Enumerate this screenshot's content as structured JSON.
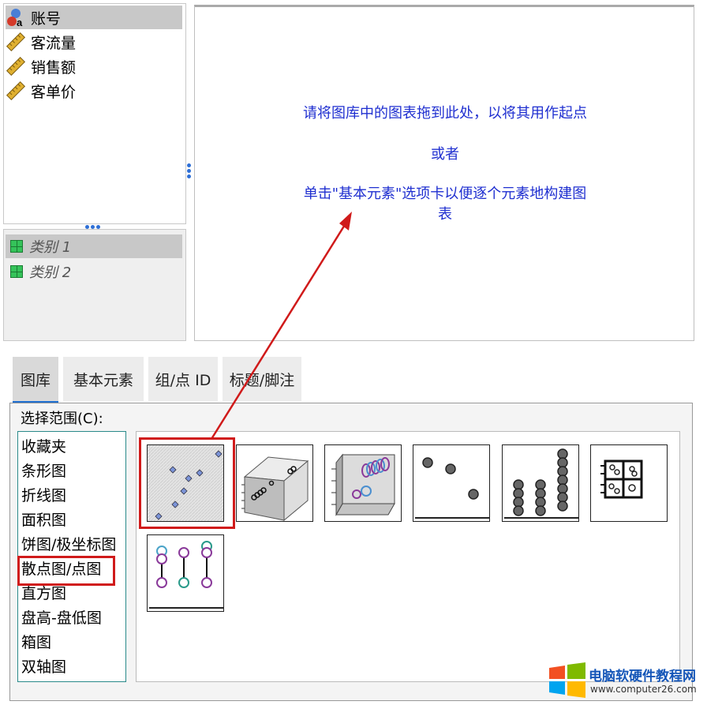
{
  "variables": [
    {
      "label": "账号",
      "icon": "nominal-variable-icon"
    },
    {
      "label": "客流量",
      "icon": "scale-ruler-icon"
    },
    {
      "label": "销售额",
      "icon": "scale-ruler-icon"
    },
    {
      "label": "客单价",
      "icon": "scale-ruler-icon"
    }
  ],
  "categories": [
    {
      "label": "类别 1"
    },
    {
      "label": "类别 2"
    }
  ],
  "canvas": {
    "line1": "请将图库中的图表拖到此处，以将其用作起点",
    "line2": "或者",
    "line3a": "单击\"基本元素\"选项卡以便逐个元素地构建图",
    "line3b": "表"
  },
  "tabs": [
    {
      "label": "图库",
      "active": true
    },
    {
      "label": "基本元素"
    },
    {
      "label": "组/点 ID"
    },
    {
      "label": "标题/脚注"
    }
  ],
  "gallery": {
    "range_label": "选择范围(C):",
    "types": [
      "收藏夹",
      "条形图",
      "折线图",
      "面积图",
      "饼图/极坐标图",
      "散点图/点图",
      "直方图",
      "盘高-盘低图",
      "箱图",
      "双轴图"
    ],
    "selected_type": "散点图/点图",
    "thumbnails": [
      "simple-scatter-thumb",
      "3d-scatter-thumb",
      "grouped-3d-scatter-thumb",
      "simple-dot-plot-thumb",
      "stacked-dot-plot-thumb",
      "scatter-matrix-thumb",
      "drop-line-thumb"
    ]
  },
  "colors": {
    "hint_text": "#1f2fd0",
    "highlight": "#d01a1a",
    "tab_accent": "#1f6fd0"
  },
  "watermark": {
    "title": "电脑软硬件教程网",
    "url": "www.computer26.com"
  }
}
